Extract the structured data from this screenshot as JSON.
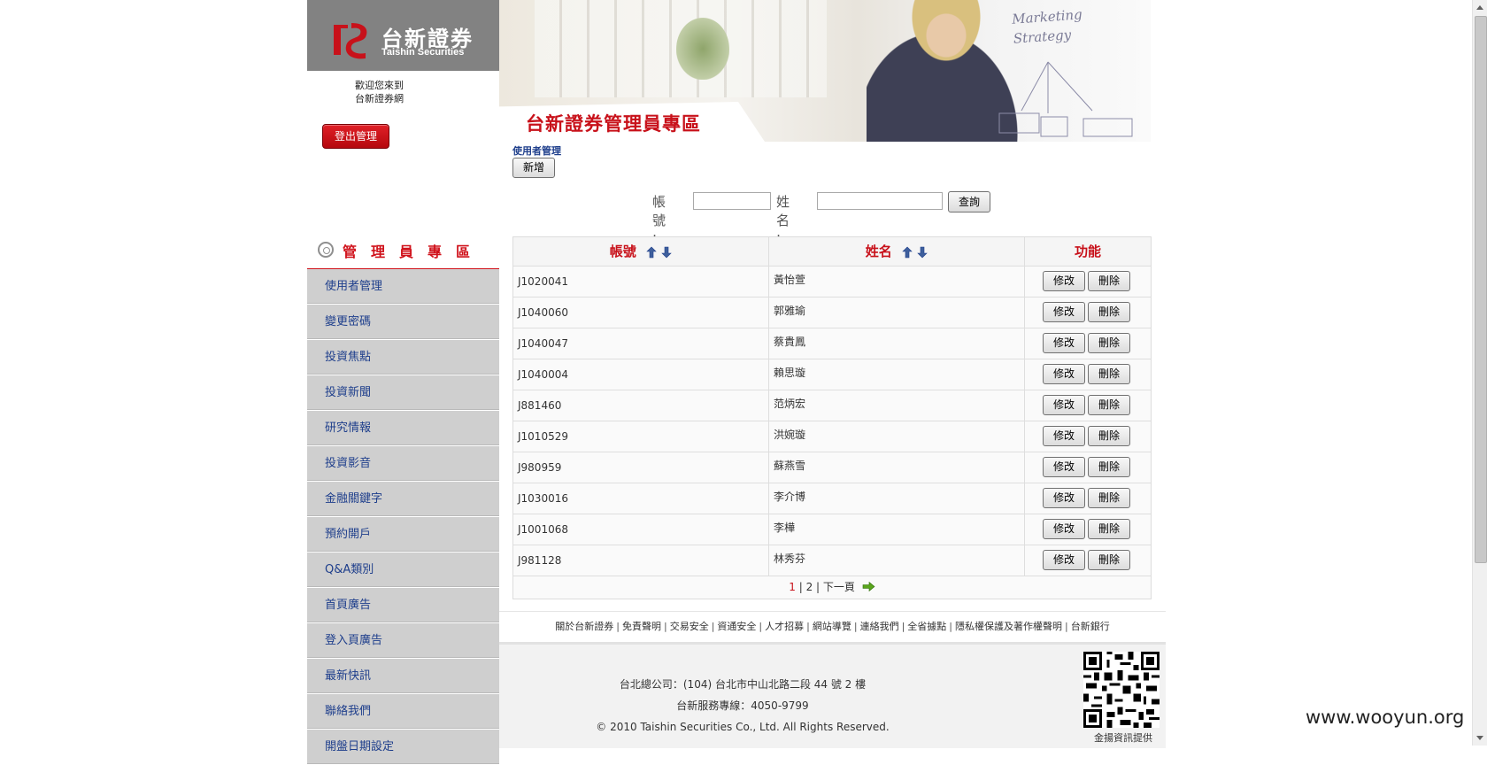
{
  "brand": {
    "name_cn": "台新證券",
    "name_en": "Taishin Securities",
    "welcome_line1": "歡迎您來到",
    "welcome_line2": "台新證券網"
  },
  "logout_label": "登出管理",
  "banner": {
    "title": "台新證券管理員專區",
    "board_text_line1": "Marketing",
    "board_text_line2": "Strategy"
  },
  "admin_section_title": "管理員專區",
  "sidebar": {
    "items": [
      {
        "label": "使用者管理"
      },
      {
        "label": "變更密碼"
      },
      {
        "label": "投資焦點"
      },
      {
        "label": "投資新聞"
      },
      {
        "label": "研究情報"
      },
      {
        "label": "投資影音"
      },
      {
        "label": "金融關鍵字"
      },
      {
        "label": "預約開戶"
      },
      {
        "label": "Q&A類別"
      },
      {
        "label": "首頁廣告"
      },
      {
        "label": "登入頁廣告"
      },
      {
        "label": "最新快訊"
      },
      {
        "label": "聯絡我們"
      },
      {
        "label": "開盤日期設定"
      }
    ]
  },
  "content": {
    "section_title": "使用者管理",
    "add_label": "新增",
    "search": {
      "account_label": "帳號 :",
      "account_value": "",
      "name_label": "姓名 :",
      "name_value": "",
      "submit_label": "查詢"
    }
  },
  "table": {
    "headers": {
      "account": "帳號",
      "name": "姓名",
      "action": "功能"
    },
    "edit_label": "修改",
    "delete_label": "刪除",
    "rows": [
      {
        "account": "J1020041",
        "name": "黃怡萱"
      },
      {
        "account": "J1040060",
        "name": "郭雅瑜"
      },
      {
        "account": "J1040047",
        "name": "蔡貴鳳"
      },
      {
        "account": "J1040004",
        "name": "賴思璇"
      },
      {
        "account": "J881460",
        "name": "范炳宏"
      },
      {
        "account": "J1010529",
        "name": "洪婉璇"
      },
      {
        "account": "J980959",
        "name": "蘇燕雪"
      },
      {
        "account": "J1030016",
        "name": "李介博"
      },
      {
        "account": "J1001068",
        "name": "李樺"
      },
      {
        "account": "J981128",
        "name": "林秀芬"
      }
    ]
  },
  "pager": {
    "page1": "1",
    "sep": "|",
    "page2": "2",
    "next_label": "下一頁"
  },
  "footer": {
    "links": [
      "關於台新證券",
      "免責聲明",
      "交易安全",
      "資通安全",
      "人才招募",
      "網站導覽",
      "連絡我們",
      "全省據點",
      "隱私權保護及著作權聲明",
      "台新銀行"
    ],
    "address": "台北總公司：(104) 台北市中山北路二段 44 號 2 樓",
    "service": "台新服務專線：4050-9799",
    "copyright": "© 2010 Taishin Securities Co., Ltd. All Rights Reserved.",
    "qr_caption": "金揚資訊提供"
  },
  "watermark": "www.wooyun.org",
  "colors": {
    "brand_red": "#c8111a",
    "nav_blue": "#1f3f8c",
    "sidebar_gray": "#cfcfcf"
  }
}
